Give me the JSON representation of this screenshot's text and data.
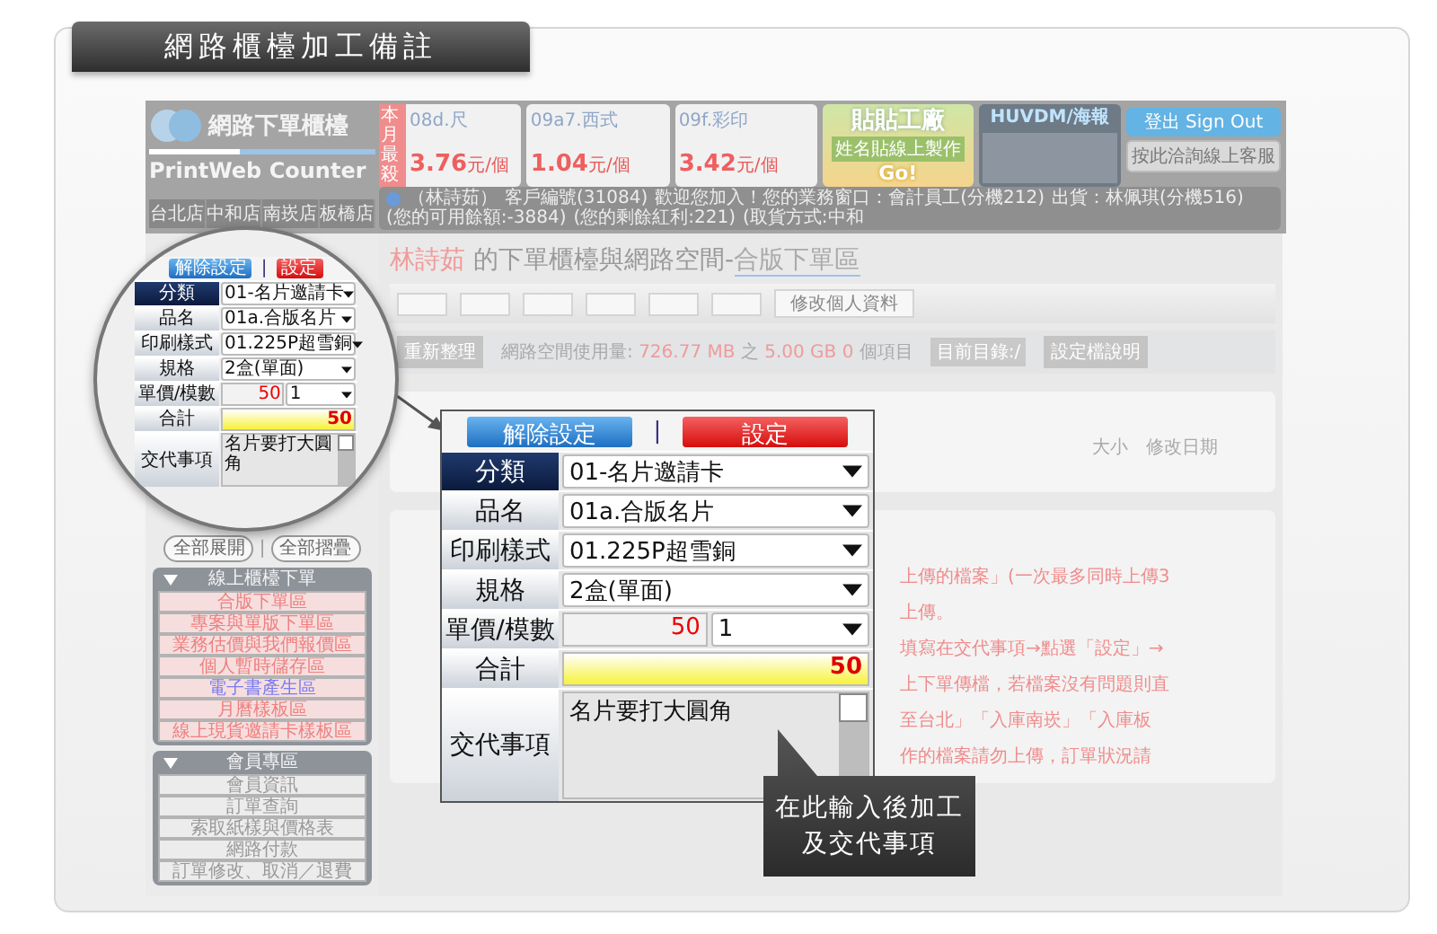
{
  "title": "網路櫃檯加工備註",
  "header": {
    "logo_text": "網路下單櫃檯",
    "logo_subtitle": "PrintWeb Counter",
    "stores": [
      "台北店",
      "中和店",
      "南崁店",
      "板橋店"
    ],
    "ads": [
      {
        "kind": "product",
        "badge": "本月最殺",
        "name": "08d.尺",
        "price": "3.76",
        "unit": "元/個"
      },
      {
        "kind": "product",
        "name": "09a7.西式",
        "price": "1.04",
        "unit": "元/個"
      },
      {
        "kind": "product",
        "name": "09f.彩印",
        "price": "3.42",
        "unit": "元/個"
      },
      {
        "kind": "promo",
        "title": "貼貼工廠",
        "subtitle": "姓名貼線上製作",
        "cta": "Go!"
      },
      {
        "kind": "photo",
        "title": "HUVDM/海報"
      }
    ],
    "sign_out": "登出 Sign Out",
    "support": "按此洽詢線上客服"
  },
  "notice": [
    "（林詩茹）",
    "客戶編號(31084)",
    "歡迎您加入！您的業務窗口：會計員工(分機212)",
    "出貨：林佩琪(分機516)",
    "(您的可用餘額:-3884)",
    "(您的剩餘紅利:221)",
    "(取貨方式:中和"
  ],
  "sidebar": {
    "expand_all": "全部展開",
    "separator": "|",
    "collapse_all": "全部摺疊",
    "sections": [
      {
        "title": "線上櫃檯下單",
        "kind": "order",
        "items": [
          {
            "label": "合版下單區",
            "kind": "normal"
          },
          {
            "label": "專案與單版下單區",
            "kind": "normal"
          },
          {
            "label": "業務估價與我們報價區",
            "kind": "normal"
          },
          {
            "label": "個人暫時儲存區",
            "kind": "normal"
          },
          {
            "label": "電子書產生區",
            "kind": "highlight"
          },
          {
            "label": "月曆樣板區",
            "kind": "normal"
          },
          {
            "label": "線上現貨邀請卡樣板區",
            "kind": "normal"
          }
        ]
      },
      {
        "title": "會員專區",
        "kind": "member",
        "items": [
          {
            "label": "會員資訊",
            "kind": "normal"
          },
          {
            "label": "訂單查詢",
            "kind": "normal"
          },
          {
            "label": "索取紙樣與價格表",
            "kind": "normal"
          },
          {
            "label": "網路付款",
            "kind": "normal"
          },
          {
            "label": "訂單修改、取消／退費",
            "kind": "normal"
          }
        ]
      }
    ]
  },
  "main": {
    "owner": "林詩茹",
    "title": "的下單櫃檯與網路空間-",
    "area": "合版下單區",
    "profile_button": "修改個人資料",
    "refresh": "重新整理",
    "usage_label": "網路空間使用量:",
    "usage_used": "726.77 MB",
    "usage_of": "之",
    "usage_total": "5.00 GB",
    "item_count": "0",
    "items_label": "個項目",
    "current_dir": "目前目錄:/",
    "settings_help": "設定檔說明",
    "columns": [
      "大小",
      "修改日期"
    ],
    "instructions": [
      "上傳的檔案」(一次最多同時上傳3",
      "上傳。",
      "填寫在交代事項→點選「設定」→",
      "上下單傳檔，若檔案沒有問題則直",
      "至台北」「入庫南崁」「入庫板",
      "作的檔案請勿上傳，訂單狀況請"
    ]
  },
  "magnifier": {
    "form": {
      "clear": "解除設定",
      "separator": "|",
      "set": "設定",
      "rows": [
        {
          "kind": "select",
          "label": "分類",
          "selected": true,
          "value": "01-名片邀請卡"
        },
        {
          "kind": "select",
          "label": "品名",
          "selected": false,
          "value": "01a.合版名片"
        },
        {
          "kind": "select",
          "label": "印刷樣式",
          "selected": false,
          "value": "01.225P超雪銅"
        },
        {
          "kind": "select",
          "label": "規格",
          "selected": false,
          "value": "2盒(單面)"
        },
        {
          "kind": "price",
          "label": "單價/模數",
          "selected": false,
          "price": "50",
          "quantity": "1"
        },
        {
          "kind": "total",
          "label": "合計",
          "selected": false,
          "value": "50"
        },
        {
          "kind": "notes",
          "label": "交代事項",
          "selected": false,
          "value": "名片要打大圓角"
        }
      ]
    }
  },
  "popup": {
    "form": {
      "clear": "解除設定",
      "separator": "|",
      "set": "設定",
      "rows": [
        {
          "kind": "select",
          "label": "分類",
          "selected": true,
          "value": "01-名片邀請卡"
        },
        {
          "kind": "select",
          "label": "品名",
          "selected": false,
          "value": "01a.合版名片"
        },
        {
          "kind": "select",
          "label": "印刷樣式",
          "selected": false,
          "value": "01.225P超雪銅"
        },
        {
          "kind": "select",
          "label": "規格",
          "selected": false,
          "value": "2盒(單面)"
        },
        {
          "kind": "price",
          "label": "單價/模數",
          "selected": false,
          "price": "50",
          "quantity": "1"
        },
        {
          "kind": "total",
          "label": "合計",
          "selected": false,
          "value": "50"
        },
        {
          "kind": "notes",
          "label": "交代事項",
          "selected": false,
          "value": "名片要打大圓角"
        }
      ]
    }
  },
  "tooltip": [
    "在此輸入後加工",
    "及交代事項"
  ]
}
